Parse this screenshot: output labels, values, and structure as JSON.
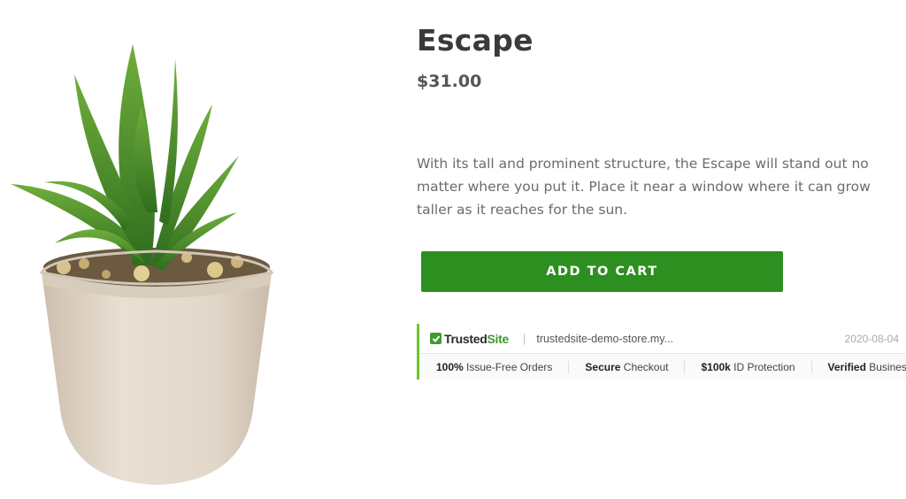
{
  "product": {
    "title": "Escape",
    "price": "$31.00",
    "description_lines": [
      "With its tall and prominent structure, the Escape will stand out no",
      "matter where you put it. Place it near a window where it can grow",
      "taller as it reaches for the sun."
    ],
    "add_to_cart_label": "ADD TO CART",
    "image_icon": "succulent-plant-in-pot"
  },
  "trust_badge": {
    "brand_main": "Trusted",
    "brand_accent": "Site",
    "separator": "|",
    "store_url": "trustedsite-demo-store.my...",
    "date": "2020-08-04",
    "badges": [
      {
        "bold": "100%",
        "text": " Issue-Free Orders"
      },
      {
        "bold": "Secure",
        "text": " Checkout"
      },
      {
        "bold": "$100k",
        "text": " ID Protection"
      },
      {
        "bold": "Verified",
        "text": " Business"
      }
    ]
  },
  "colors": {
    "button": "#2c8f1f",
    "trust_accent": "#6cc72a",
    "brand_green": "#3d9b2b"
  }
}
